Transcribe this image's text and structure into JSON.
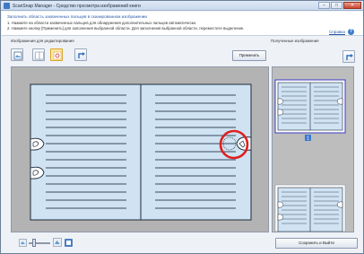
{
  "window": {
    "title": "ScanSnap Manager - Средство просмотра изображений книги",
    "minimize": "–",
    "maximize": "□",
    "close": "✕"
  },
  "info": {
    "heading": "Заполнить область захваченных пальцев в сканированном изображении",
    "step1": "1. Нажмите на области захваченных пальцев для обнаружения дополнительных пальцев автоматически.",
    "step2": "2. Нажмите кнопку [Применить] для заполнения выбранной области. Для заполнения выбранной области, переместите выделение.",
    "help_link": "Справка",
    "help_icon": "?"
  },
  "toolbar": {
    "label": "Изображения для редактирования",
    "apply": "Применить"
  },
  "side_panel": {
    "label": "Полученные изображения",
    "page_badge": "1"
  },
  "bottom": {
    "save": "Сохранить и Выйти"
  },
  "colors": {
    "page_fill": "#cfe3f3",
    "highlight_ring": "#e02020",
    "selection_frame": "#3b3bc8"
  },
  "icons": [
    "single-page-icon",
    "double-page-icon",
    "selected-area-icon",
    "rotate-icon",
    "zoom-out-icon",
    "zoom-in-icon",
    "fit-icon",
    "side-rotate-icon"
  ]
}
